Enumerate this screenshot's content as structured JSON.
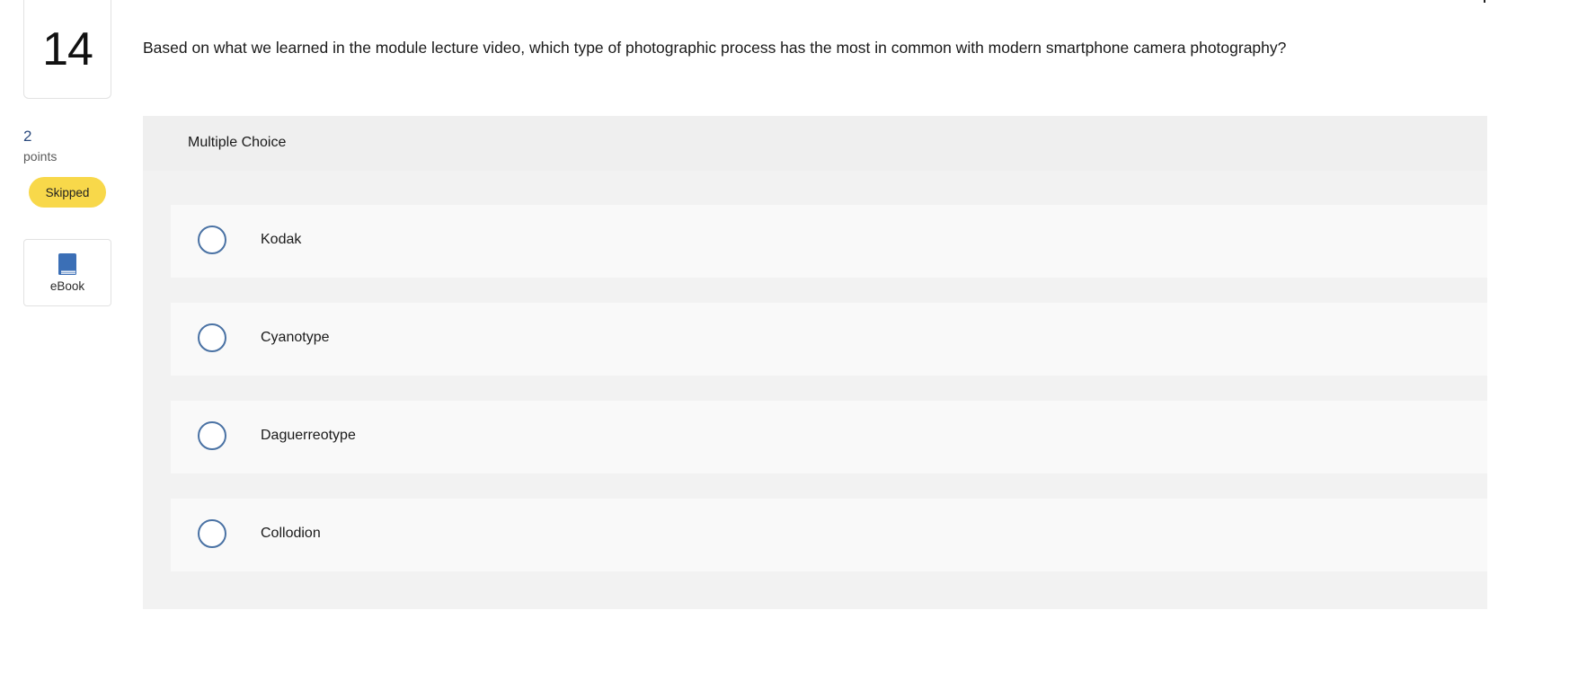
{
  "question": {
    "number": "14",
    "text": "Based on what we learned in the module lecture video, which type of photographic process has the most in common with modern smartphone camera photography?",
    "points_value": "2",
    "points_label": "points",
    "status": "Skipped"
  },
  "ebook": {
    "icon": "book-icon",
    "label": "eBook",
    "icon_color": "#3b6fb6"
  },
  "answer_panel": {
    "type_label": "Multiple Choice",
    "options": [
      {
        "label": "Kodak"
      },
      {
        "label": "Cyanotype"
      },
      {
        "label": "Daguerreotype"
      },
      {
        "label": "Collodion"
      }
    ]
  },
  "colors": {
    "status_badge": "#f8d84a",
    "radio_border": "#4a72a4",
    "points_value": "#2b4a7e",
    "panel_background": "#f2f2f2",
    "option_background": "#f9f9f9"
  }
}
